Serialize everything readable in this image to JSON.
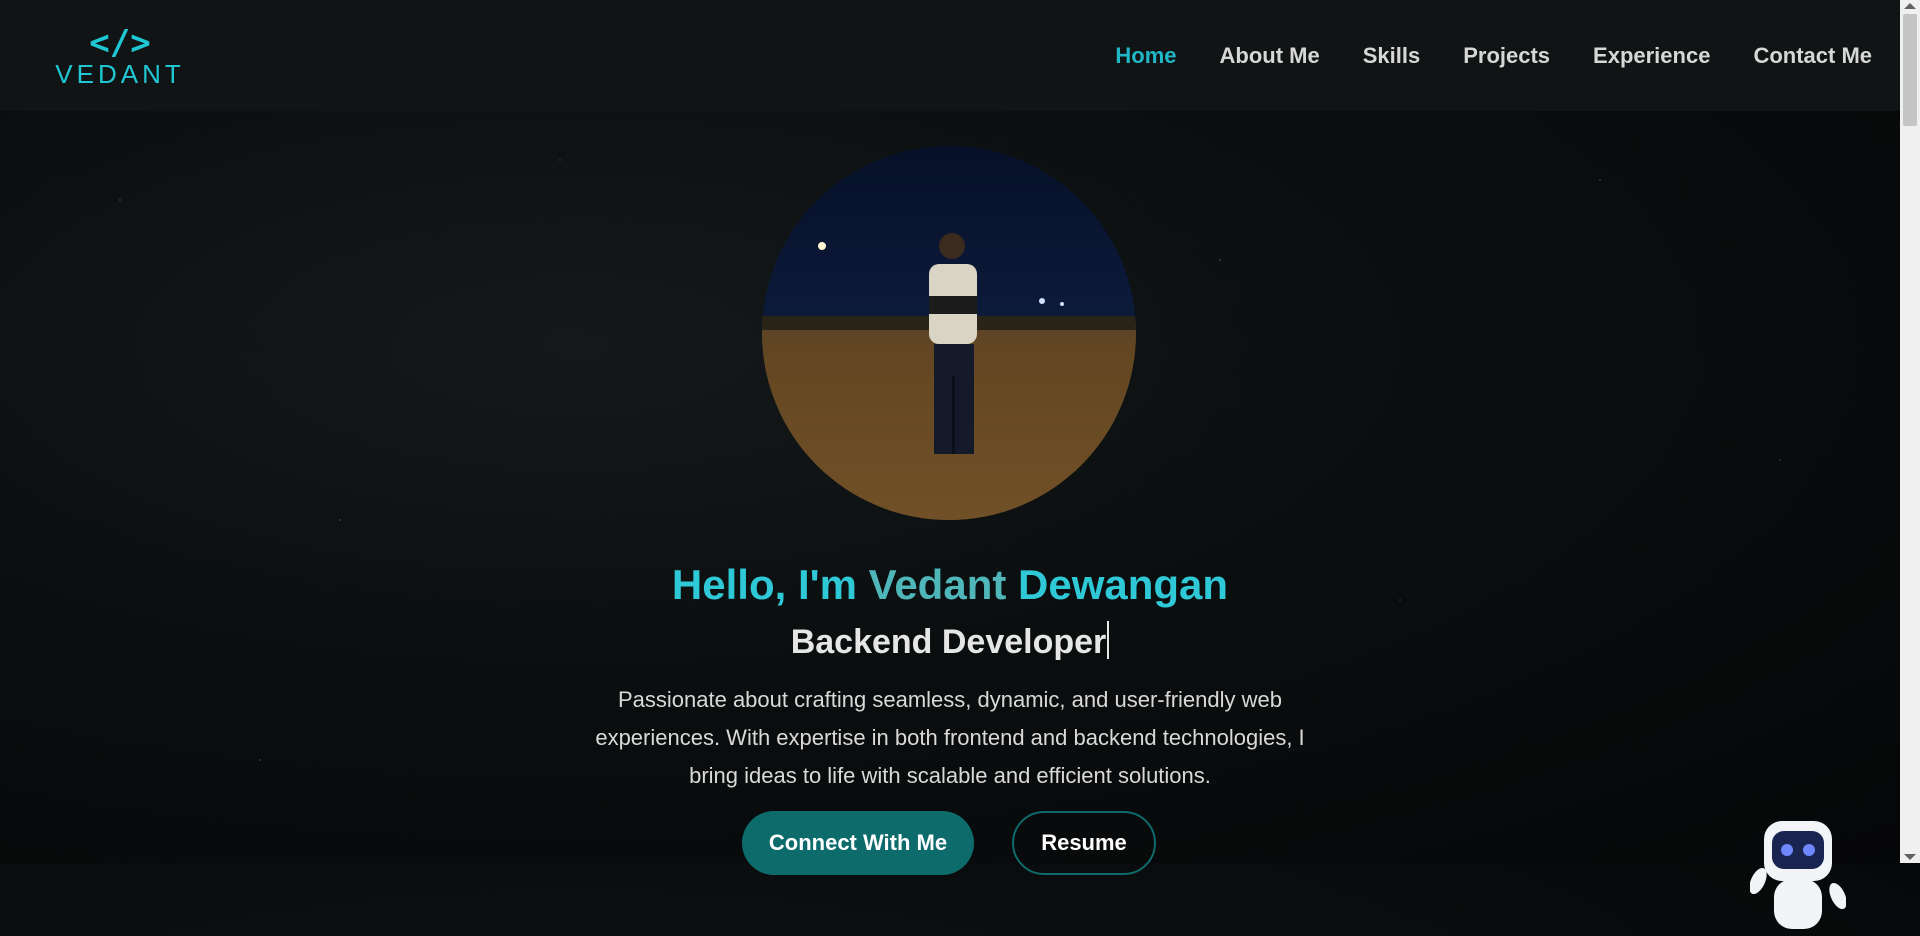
{
  "logo": {
    "mark": "</>",
    "text": "VEDANT"
  },
  "nav": {
    "items": [
      "Home",
      "About Me",
      "Skills",
      "Projects",
      "Experience",
      "Contact Me"
    ],
    "active": "Home"
  },
  "hero": {
    "greeting_start": "Hello, I'm",
    "greeting_mid": "Vedant",
    "greeting_end": "Dewangan",
    "role": "Backend Developer",
    "description": "Passionate about crafting seamless, dynamic, and user-friendly web experiences. With expertise in both frontend and backend technologies, I bring ideas to life with scalable and efficient solutions.",
    "connect_label": "Connect With Me",
    "resume_label": "Resume"
  },
  "colors": {
    "accent": "#22b7c6",
    "button": "#0d6b6c",
    "background": "#0b0e0f"
  },
  "icons": {
    "chatbot": "robot-icon"
  }
}
